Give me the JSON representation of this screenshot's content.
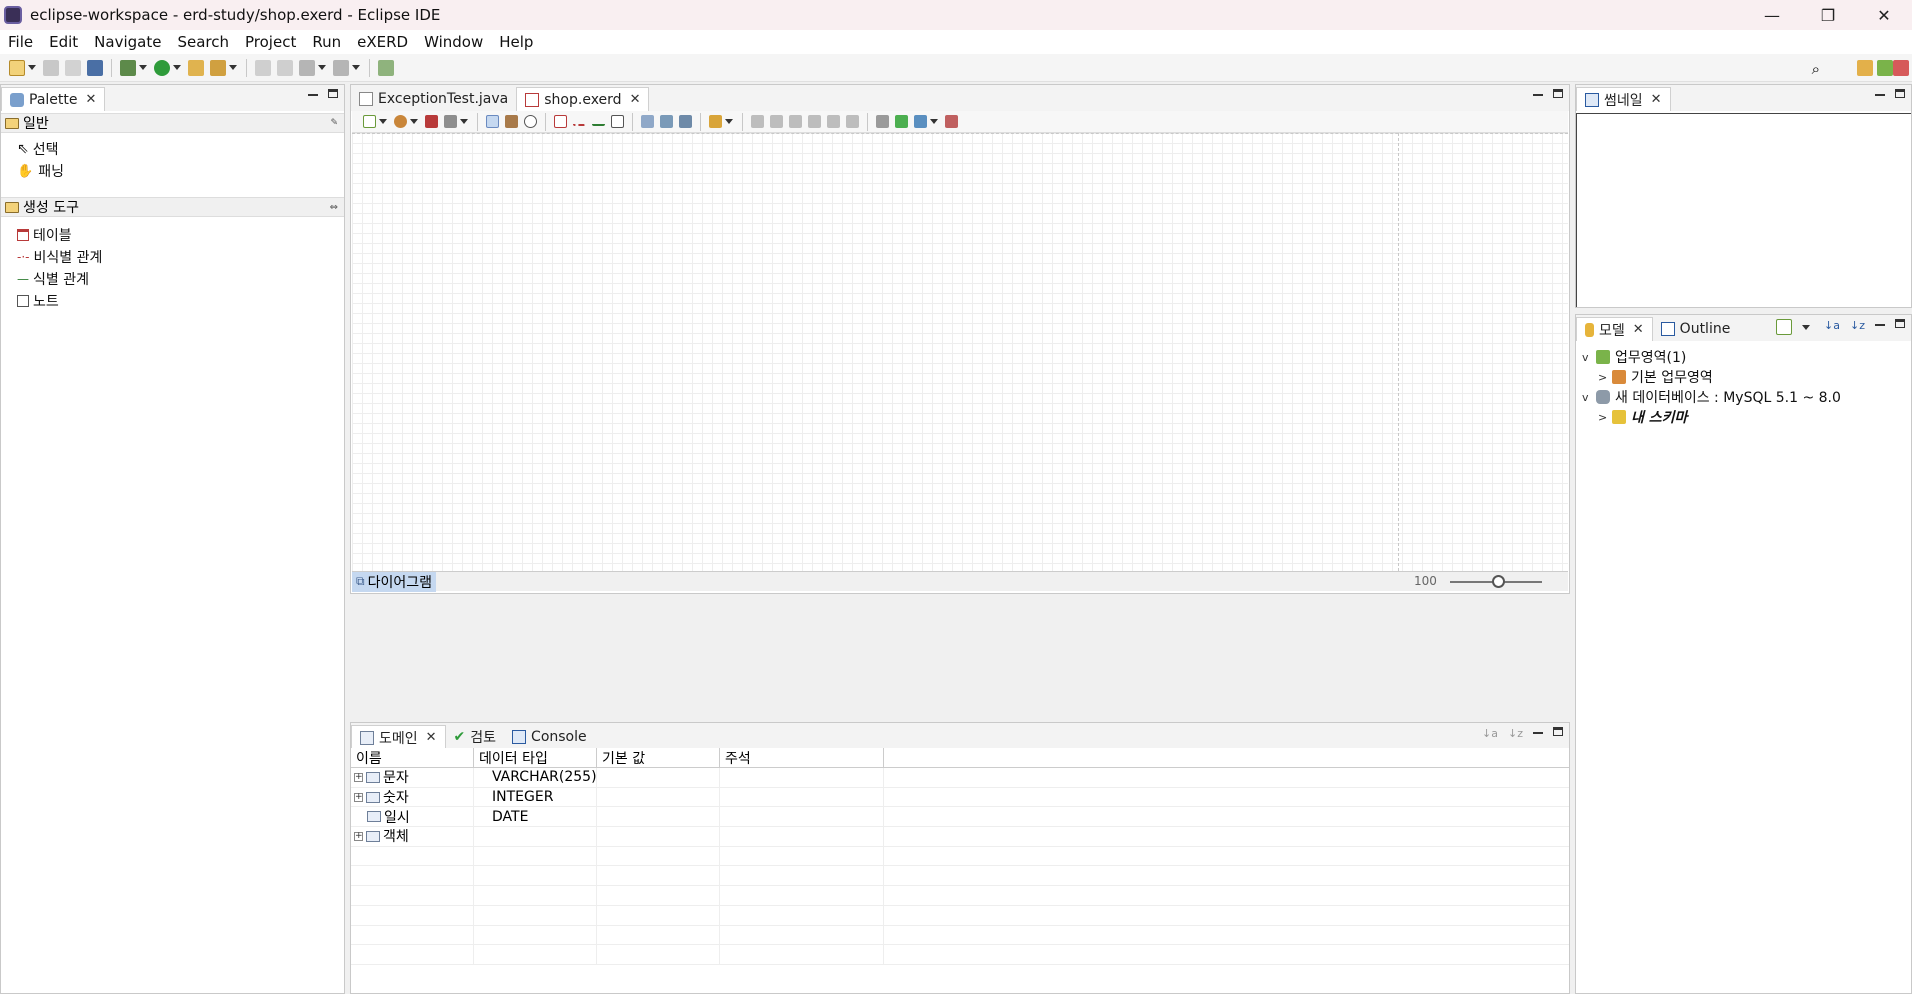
{
  "window": {
    "title": "eclipse-workspace - erd-study/shop.exerd - Eclipse IDE",
    "minimize": "—",
    "restore": "❐",
    "close": "✕"
  },
  "menu": [
    "File",
    "Edit",
    "Navigate",
    "Search",
    "Project",
    "Run",
    "eXERD",
    "Window",
    "Help"
  ],
  "palette": {
    "tab": "Palette",
    "group_general": "일반",
    "select": "선택",
    "pan": "패닝",
    "group_create": "생성 도구",
    "table": "테이블",
    "non_identifying": "비식별 관계",
    "identifying": "식별 관계",
    "note": "노트"
  },
  "editor": {
    "tabs": [
      "ExceptionTest.java",
      "shop.exerd"
    ],
    "diagram_tab": "다이어그램",
    "zoom": "100"
  },
  "bottom": {
    "tabs": [
      "도메인",
      "검토",
      "Console"
    ],
    "columns": [
      "이름",
      "데이터 타입",
      "기본 값",
      "주석"
    ],
    "rows": [
      {
        "name": "문자",
        "type": "VARCHAR(255)",
        "expand": "+"
      },
      {
        "name": "숫자",
        "type": "INTEGER",
        "expand": "+"
      },
      {
        "name": "일시",
        "type": "DATE",
        "expand": ""
      },
      {
        "name": "객체",
        "type": "",
        "expand": "+"
      }
    ]
  },
  "thumbnail": {
    "tab": "썸네일"
  },
  "model": {
    "tabs": [
      "모델",
      "Outline"
    ],
    "tree": [
      {
        "label": "업무영역(1)",
        "chevron": "v"
      },
      {
        "label": "기본 업무영역",
        "chevron": ">"
      },
      {
        "label": "새 데이터베이스 : MySQL 5.1 ~ 8.0",
        "chevron": "v"
      },
      {
        "label": "내 스키마",
        "chevron": ">"
      }
    ]
  },
  "colors": {
    "accent": "#c5d8f0",
    "selection": "#c5d8f0"
  }
}
